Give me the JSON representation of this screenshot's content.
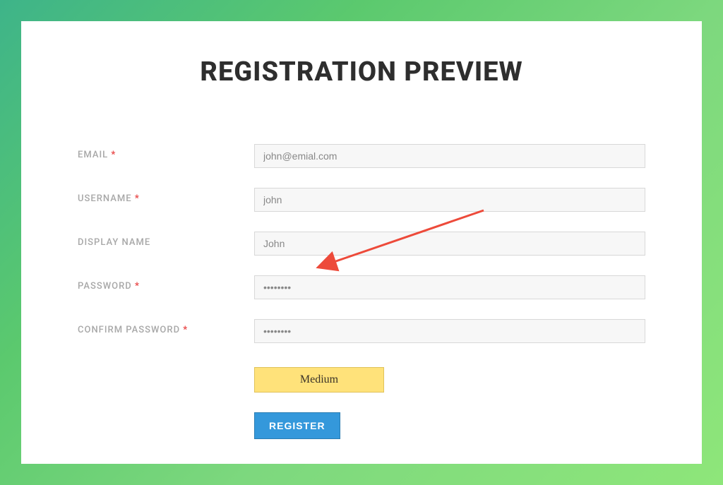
{
  "title": "REGISTRATION PREVIEW",
  "fields": {
    "email": {
      "label": "EMAIL",
      "required": "*",
      "value": "john@emial.com"
    },
    "username": {
      "label": "USERNAME",
      "required": "*",
      "value": "john"
    },
    "display_name": {
      "label": "DISPLAY NAME",
      "required": "",
      "value": "John"
    },
    "password": {
      "label": "PASSWORD",
      "required": "*"
    },
    "confirm_password": {
      "label": "CONFIRM PASSWORD",
      "required": "*"
    }
  },
  "strength": {
    "label": "Medium"
  },
  "register": {
    "label": "REGISTER"
  }
}
